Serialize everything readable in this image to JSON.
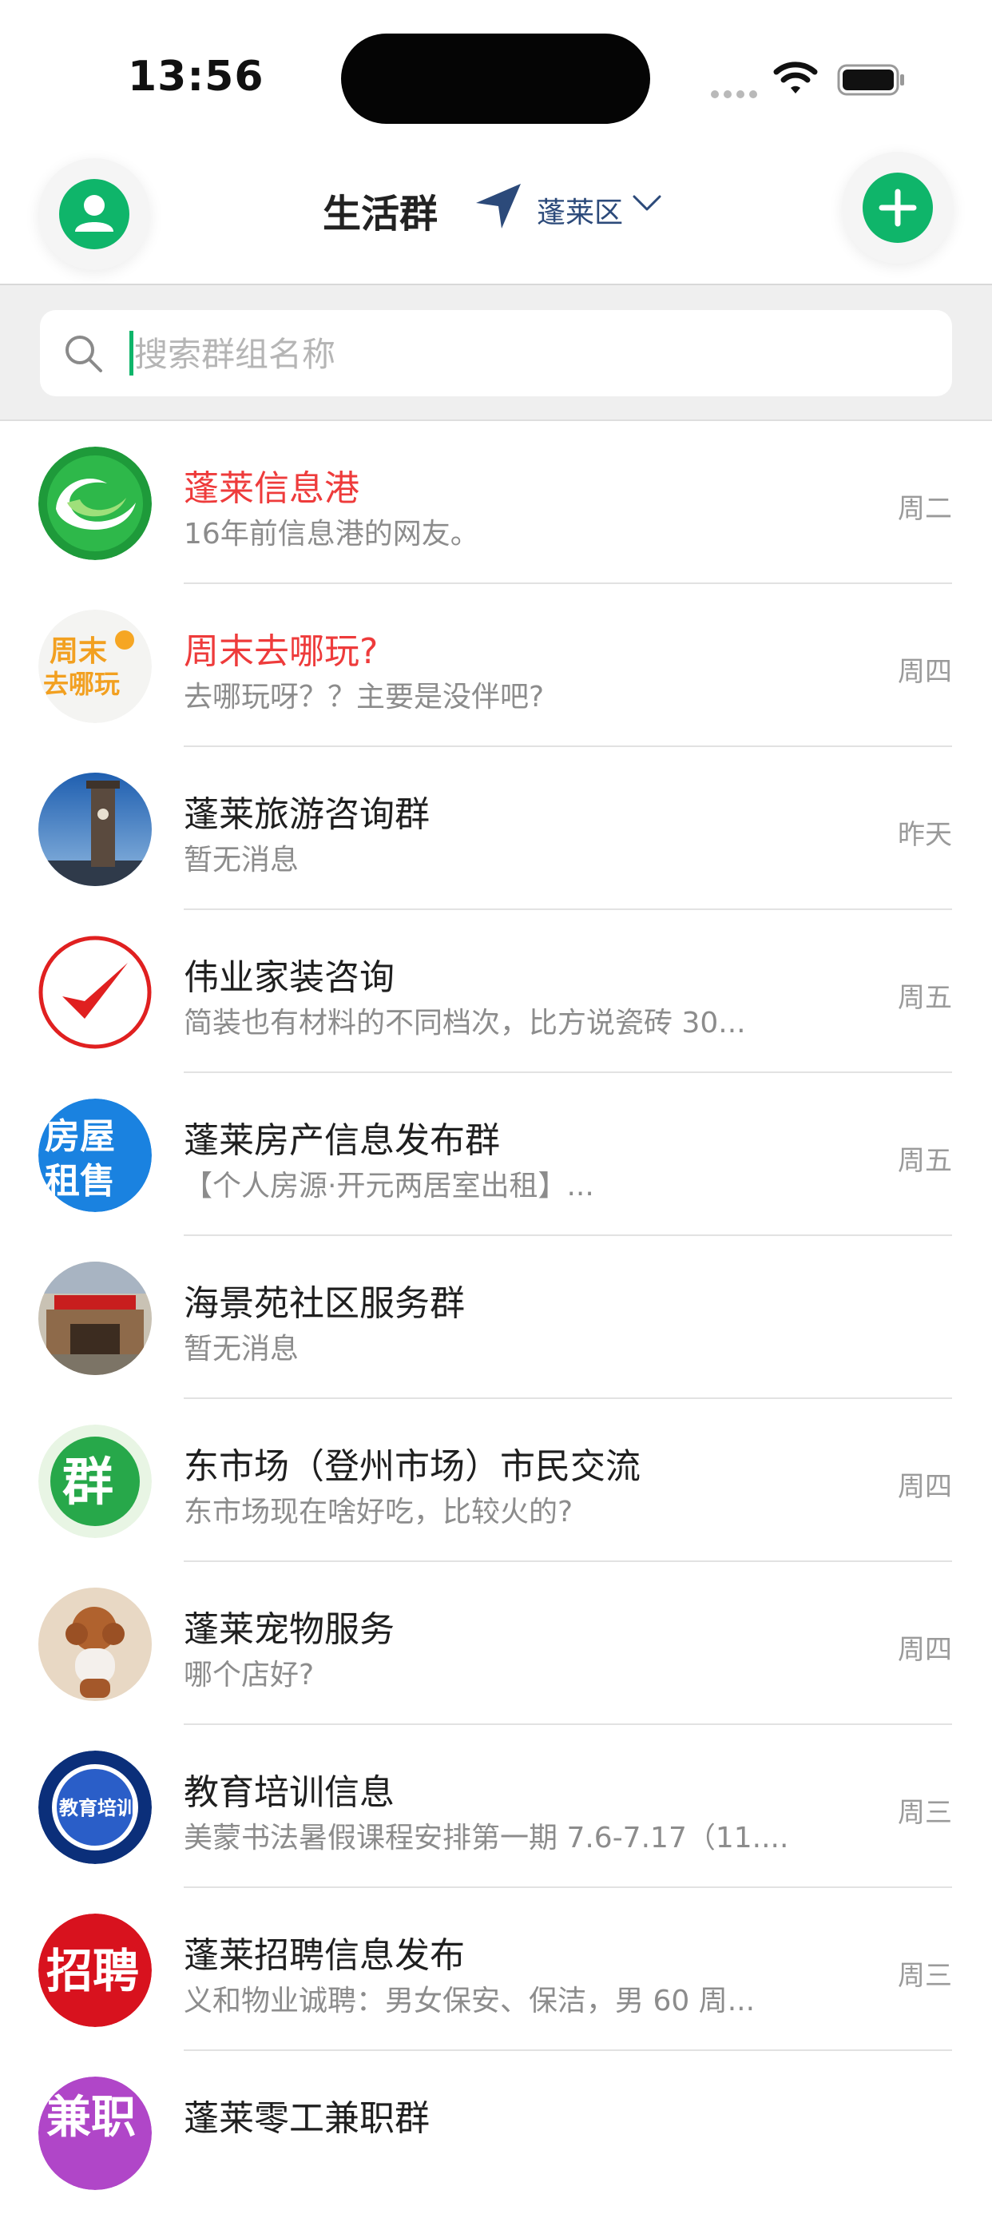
{
  "status_bar": {
    "time": "13:56"
  },
  "header": {
    "title": "生活群",
    "location": "蓬莱区"
  },
  "search": {
    "placeholder": "搜索群组名称",
    "value": ""
  },
  "groups": [
    {
      "name": "蓬莱信息港",
      "last_message": "16年前信息港的网友。",
      "day": "周二",
      "highlight": true,
      "icon": "swirl-logo-icon"
    },
    {
      "name": "周末去哪玩?",
      "last_message": "去哪玩呀？？主要是没伴吧?",
      "day": "周四",
      "highlight": true,
      "icon": "weekend-text-logo-icon"
    },
    {
      "name": "蓬莱旅游咨询群",
      "last_message": "暂无消息",
      "day": "昨天",
      "highlight": false,
      "icon": "tower-photo-icon"
    },
    {
      "name": "伟业家装咨询",
      "last_message": "简装也有材料的不同档次，比方说瓷砖 30...",
      "day": "周五",
      "highlight": false,
      "icon": "checkmark-logo-icon"
    },
    {
      "name": "蓬莱房产信息发布群",
      "last_message": "【个人房源·开元两居室出租】...",
      "day": "周五",
      "highlight": false,
      "icon": "house-rent-logo-icon"
    },
    {
      "name": "海景苑社区服务群",
      "last_message": "暂无消息",
      "day": "",
      "highlight": false,
      "icon": "community-center-photo-icon"
    },
    {
      "name": "东市场（登州市场）市民交流",
      "last_message": "东市场现在啥好吃，比较火的?",
      "day": "周四",
      "highlight": false,
      "icon": "group-char-logo-icon"
    },
    {
      "name": "蓬莱宠物服务",
      "last_message": "哪个店好?",
      "day": "周四",
      "highlight": false,
      "icon": "poodle-photo-icon"
    },
    {
      "name": "教育培训信息",
      "last_message": "美蒙书法暑假课程安排第一期 7.6-7.17（11....",
      "day": "周三",
      "highlight": false,
      "icon": "education-badge-icon"
    },
    {
      "name": "蓬莱招聘信息发布",
      "last_message": "义和物业诚聘：男女保安、保洁，男 60 周...",
      "day": "周三",
      "highlight": false,
      "icon": "recruit-logo-icon"
    },
    {
      "name": "蓬莱零工兼职群",
      "last_message": "",
      "day": "",
      "highlight": false,
      "icon": "parttime-logo-icon"
    }
  ],
  "icon_texts": {
    "weekend_1": "周末",
    "weekend_2": "去哪玩",
    "house_1": "房屋",
    "house_2": "租售",
    "group_char": "群",
    "education": "教育培训",
    "recruit": "招聘",
    "parttime": "兼职"
  },
  "colors": {
    "accent_green": "#0fb56a",
    "highlight_red": "#ee3b3b",
    "location_blue": "#2c4a7a"
  }
}
